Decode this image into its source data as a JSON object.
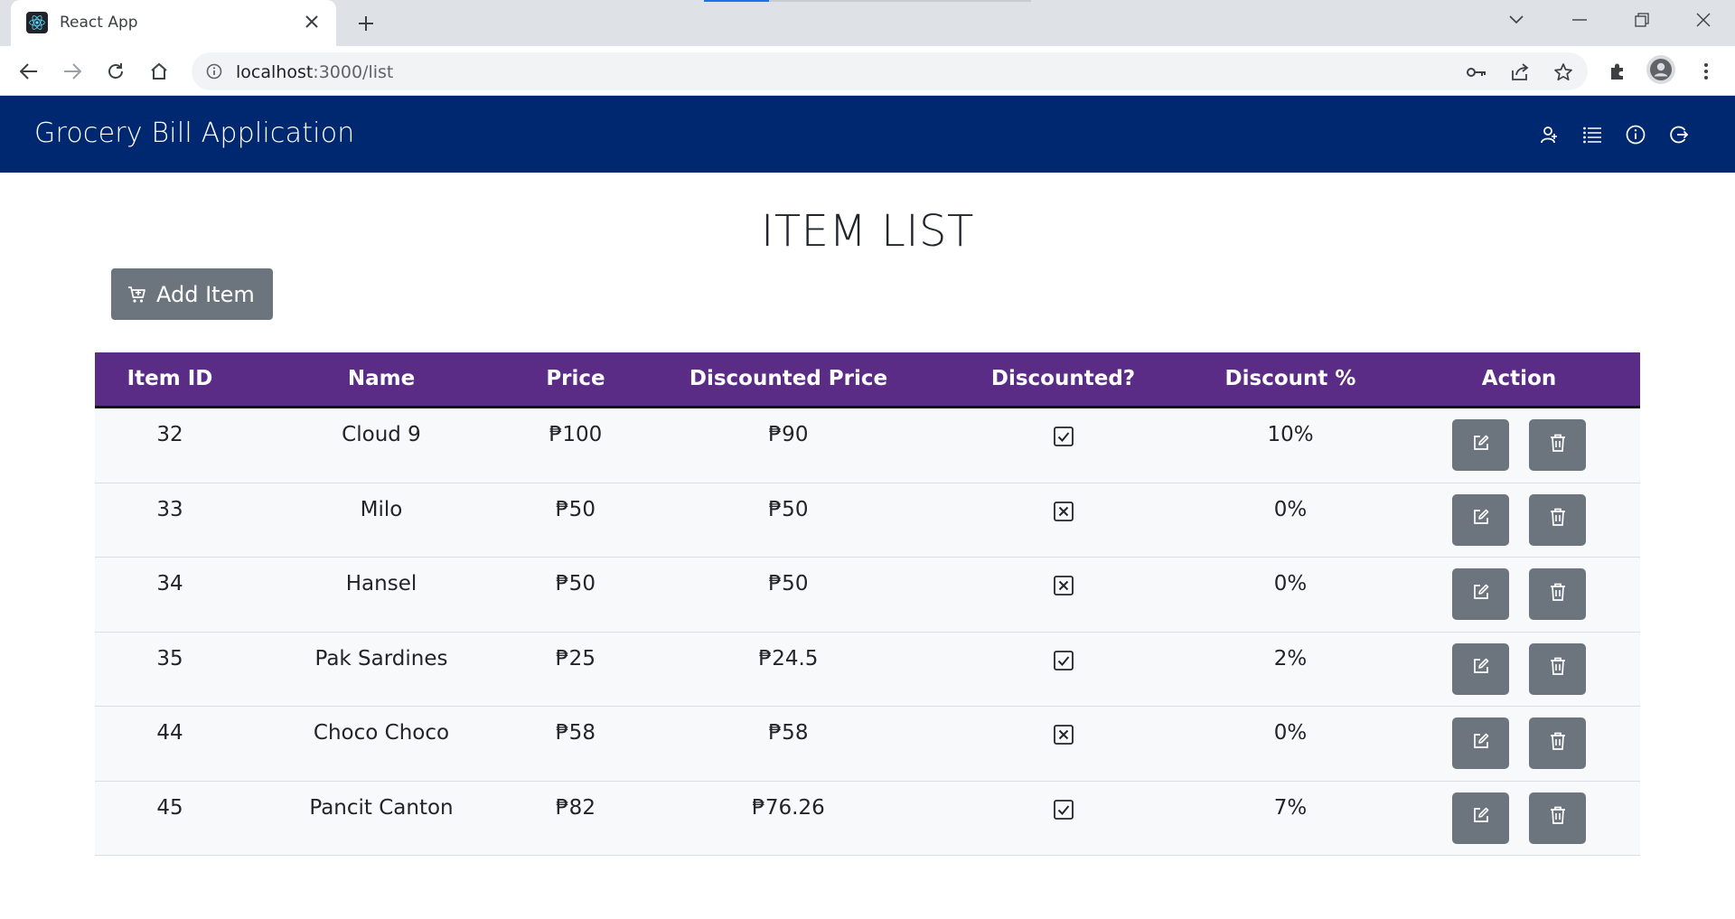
{
  "browser": {
    "tab_title": "React App",
    "url_host": "localhost",
    "url_path": ":3000/list"
  },
  "navbar": {
    "brand": "Grocery Bill Application",
    "icons": [
      "user-icon",
      "list-icon",
      "info-icon",
      "logout-icon"
    ]
  },
  "page": {
    "title": "ITEM LIST",
    "add_button_label": "Add Item"
  },
  "table": {
    "headers": [
      "Item ID",
      "Name",
      "Price",
      "Discounted Price",
      "Discounted?",
      "Discount %",
      "Action"
    ],
    "rows": [
      {
        "id": "32",
        "name": "Cloud 9",
        "price": "₱100",
        "discounted_price": "₱90",
        "discounted": true,
        "discount_pct": "10%"
      },
      {
        "id": "33",
        "name": "Milo",
        "price": "₱50",
        "discounted_price": "₱50",
        "discounted": false,
        "discount_pct": "0%"
      },
      {
        "id": "34",
        "name": "Hansel",
        "price": "₱50",
        "discounted_price": "₱50",
        "discounted": false,
        "discount_pct": "0%"
      },
      {
        "id": "35",
        "name": "Pak Sardines",
        "price": "₱25",
        "discounted_price": "₱24.5",
        "discounted": true,
        "discount_pct": "2%"
      },
      {
        "id": "44",
        "name": "Choco Choco",
        "price": "₱58",
        "discounted_price": "₱58",
        "discounted": false,
        "discount_pct": "0%"
      },
      {
        "id": "45",
        "name": "Pancit Canton",
        "price": "₱82",
        "discounted_price": "₱76.26",
        "discounted": true,
        "discount_pct": "7%"
      }
    ]
  },
  "colors": {
    "navbar": "#002871",
    "table_header": "#5b2c86",
    "button": "#6c757d"
  }
}
